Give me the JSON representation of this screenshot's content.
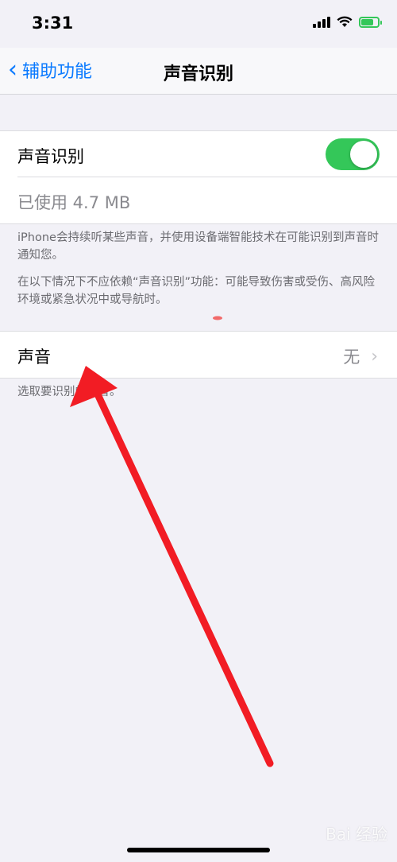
{
  "status_bar": {
    "time": "3:31"
  },
  "nav": {
    "back_label": "辅助功能",
    "title": "声音识别"
  },
  "settings": {
    "sound_recognition_label": "声音识别",
    "sound_recognition_enabled": true,
    "storage_used": "已使用 4.7 MB"
  },
  "footer_note": {
    "paragraph1": "iPhone会持续听某些声音，并使用设备端智能技术在可能识别到声音时通知您。",
    "paragraph2": "在以下情况下不应依赖“声音识别”功能：可能导致伤害或受伤、高风险环境或紧急状况中或导航时。"
  },
  "sounds": {
    "label": "声音",
    "value": "无"
  },
  "sounds_footer": "选取要识别的声音。",
  "watermark": "Bai 经验",
  "colors": {
    "accent": "#0a7aff",
    "toggle_on": "#34c759",
    "arrow": "#f21c24"
  }
}
